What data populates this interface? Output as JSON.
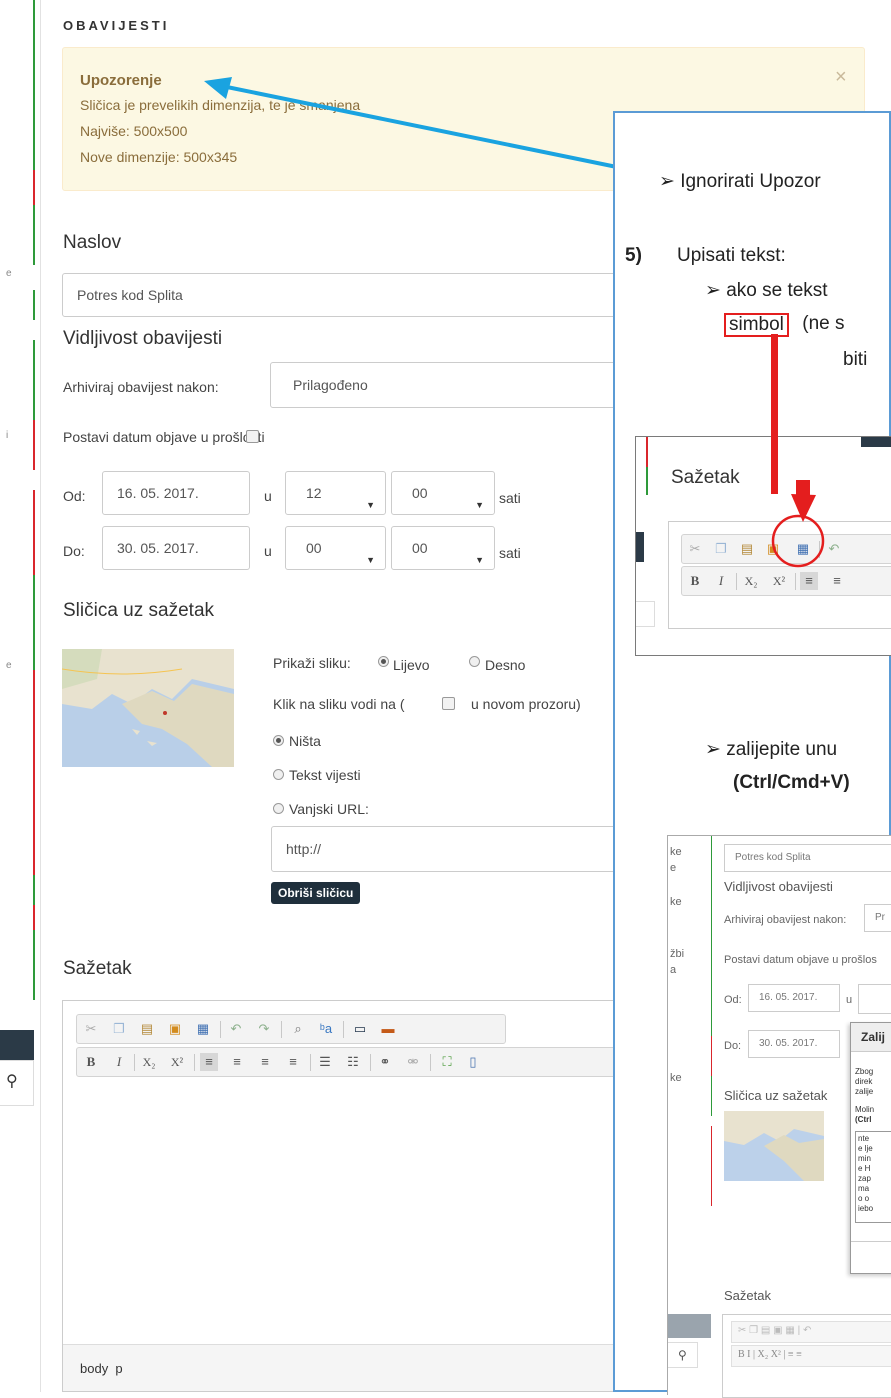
{
  "notifications": {
    "section_title": "OBAVIJESTI",
    "alert": {
      "title": "Upozorenje",
      "line1": "Sličica je prevelikih dimenzija, te je smanjena",
      "line2": "Najviše: 500x500",
      "line3": "Nove dimenzije: 500x345",
      "close": "×"
    }
  },
  "form": {
    "naslov_label": "Naslov",
    "naslov_value": "Potres kod Splita",
    "vidljivost_label": "Vidljivost obavijesti",
    "arhiviraj_label": "Arhiviraj obavijest nakon:",
    "arhiviraj_value": "Prilagođeno",
    "postavi_label": "Postavi datum objave u prošlosti",
    "od_label": "Od:",
    "od_date": "16. 05. 2017.",
    "od_u": "u",
    "od_hour": "12",
    "od_min": "00",
    "od_sati": "sati",
    "do_label": "Do:",
    "do_date": "30. 05. 2017.",
    "do_u": "u",
    "do_hour": "00",
    "do_min": "00",
    "do_sati": "sati",
    "slicica_label": "Sličica uz sažetak",
    "prikazi_label": "Prikaži sliku:",
    "lijevo": "Lijevo",
    "desno": "Desno",
    "klik_label": "Klik na sliku vodi na (",
    "novi_prozor": "u novom prozoru)",
    "nista": "Ništa",
    "tekst_vijesti": "Tekst vijesti",
    "vanjski_url": "Vanjski URL:",
    "url_value": "http://",
    "obrisi": "Obriši sličicu",
    "sazetak_label": "Sažetak",
    "status_path": "body  p"
  },
  "sidebar": {
    "search_icon": "⚲"
  },
  "instructions": {
    "bullet1": "➢ Ignorirati Upozor",
    "step_num": "5)",
    "step_text": "Upisati tekst:",
    "bullet2": "➢   ako se tekst",
    "simbol": "simbol",
    "ne_s": " (ne s",
    "biti": "biti",
    "bullet3": "➢   zalijepite unu",
    "ctrl": "(Ctrl/Cmd+V)"
  },
  "screenshot1": {
    "title": "Sažetak",
    "tab_stub": "Sa"
  },
  "screenshot2": {
    "naslov_value": "Potres kod Splita",
    "vidljivost": "Vidljivost obavijesti",
    "arhiviraj": "Arhiviraj obavijest nakon:",
    "arhiviraj_val": "Pr",
    "postavi": "Postavi datum objave u prošlos",
    "od": "Od:",
    "od_date": "16. 05. 2017.",
    "u": "u",
    "do": "Do:",
    "do_date": "30. 05. 2017.",
    "dialog_title": "Zalij",
    "dialog_l1": "Zbog",
    "dialog_l2": "direk",
    "dialog_l3": "zalije",
    "dialog_l4": "Molin",
    "dialog_l5": "(Ctrl",
    "paste_lines": [
      "nte",
      "e lje",
      "min",
      "e H",
      "zap",
      "ma",
      "o o",
      "iebo"
    ],
    "slicica": "Sličica uz sažetak",
    "sazetak": "Sažetak",
    "side_labels": [
      "ke",
      "e",
      "ke",
      "žbi",
      "a",
      "ke"
    ]
  },
  "colors": {
    "alert_bg": "#fcf8e3",
    "alert_text": "#8a6d3b",
    "arrow_blue": "#1aa3e0",
    "arrow_red": "#e41e1e",
    "card_border": "#5b9bd5",
    "dark_button": "#1f2f3c"
  }
}
